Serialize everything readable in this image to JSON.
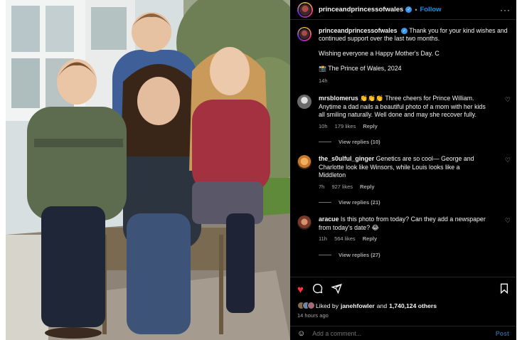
{
  "photo": {
    "alt_icon": "family-photo"
  },
  "header": {
    "username": "princeandprincessofwales",
    "separator": "•",
    "follow_label": "Follow",
    "more_label": "···"
  },
  "caption": {
    "username": "princeandprincessofwales",
    "text": "Thank you for your kind wishes and continued support over the last two months.",
    "line2": "Wishing everyone a Happy Mother's Day. C",
    "credit": "📸 The Prince of Wales, 2024",
    "time": "14h"
  },
  "comments": [
    {
      "username": "mrsblomerus",
      "text": "👏👏👏 Three cheers for Prince William. Anytime a dad nails a beautiful photo of a mom with her kids all smiling naturally. Well done and may she recover fully.",
      "time": "10h",
      "likes": "179 likes",
      "reply": "Reply",
      "view_replies": "View replies (10)",
      "avatar_color": "#9a9a9a"
    },
    {
      "username": "the_s0ulful_ginger",
      "text": "Genetics are so cool— George and Charlotte look like Winsors, while Louis looks like a Middleton",
      "time": "7h",
      "likes": "927 likes",
      "reply": "Reply",
      "view_replies": "View replies (21)",
      "avatar_color": "#c9772b"
    },
    {
      "username": "aracue",
      "text": "Is this photo from today? Can they add a newspaper from today's date? 😂",
      "time": "11h",
      "likes": "564 likes",
      "reply": "Reply",
      "view_replies": "View replies (27)",
      "avatar_color": "#7a3a2a"
    }
  ],
  "likes": {
    "prefix": "Liked by",
    "user": "janehfowler",
    "conj": "and",
    "count": "1,740,124 others"
  },
  "posted": "14 hours ago",
  "add_comment": {
    "placeholder": "Add a comment...",
    "post_label": "Post"
  },
  "colors": {
    "accent": "#0095f6",
    "like_red": "#ff3040",
    "background": "#000000",
    "muted": "#a8a8a8"
  }
}
